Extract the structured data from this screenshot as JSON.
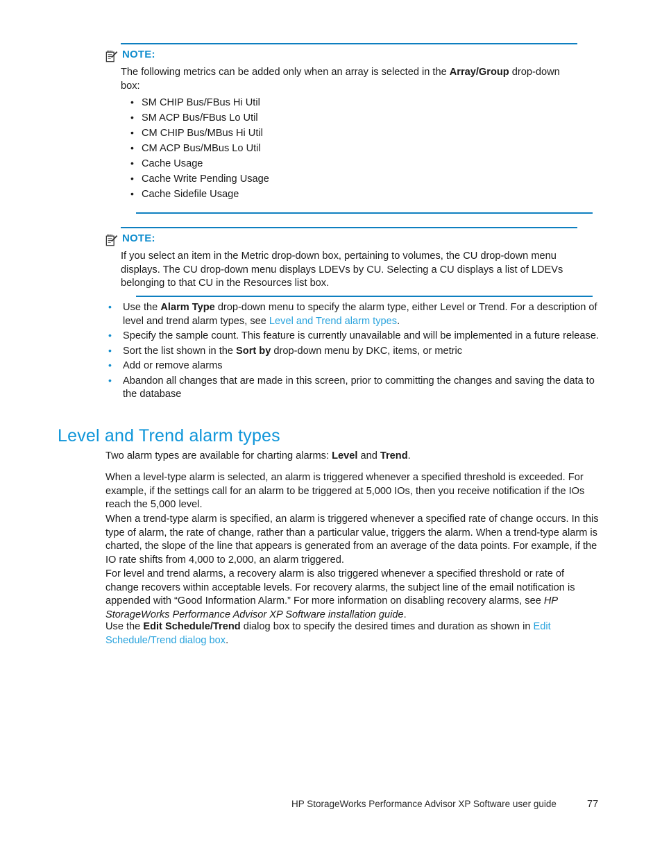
{
  "notes": [
    {
      "icon": "note-pencil-icon",
      "label": "NOTE:",
      "body": "The following metrics can be added only when an array is selected in the Array/Group drop-down box:",
      "body_pre": "The following metrics can be added only when an array is selected in the ",
      "body_bold": "Array/Group",
      "body_post": " drop-down box:",
      "items": [
        "SM CHIP Bus/FBus Hi Util",
        "SM ACP Bus/FBus Lo Util",
        "CM CHIP Bus/MBus Hi Util",
        "CM ACP Bus/MBus Lo Util",
        "Cache Usage",
        "Cache Write Pending Usage",
        "Cache Sidefile Usage"
      ]
    },
    {
      "icon": "note-pencil-icon",
      "label": "NOTE:",
      "body": "If you select an item in the Metric drop-down box, pertaining to volumes, the CU drop-down menu displays. The CU drop-down menu displays LDEVs by CU. Selecting a CU displays a list of LDEVs belonging to that CU in the Resources list box."
    }
  ],
  "main_bullets": [
    {
      "pre": "Use the ",
      "bold": "Alarm Type",
      "mid": " drop-down menu to specify the alarm type, either Level or Trend.  For a description of level and trend alarm types, see ",
      "link": "Level and Trend alarm types",
      "post": "."
    },
    {
      "pre": "Specify the sample count.  This feature is currently unavailable and will be implemented in a future release.",
      "bold": "",
      "mid": "",
      "link": "",
      "post": ""
    },
    {
      "pre": "Sort the list shown in the ",
      "bold": "Sort by",
      "mid": " drop-down menu by DKC, items, or metric",
      "link": "",
      "post": ""
    },
    {
      "pre": "Add or remove alarms",
      "bold": "",
      "mid": "",
      "link": "",
      "post": ""
    },
    {
      "pre": "Abandon all changes that are made in this screen, prior to committing the changes and saving the data to the database",
      "bold": "",
      "mid": "",
      "link": "",
      "post": ""
    }
  ],
  "section": {
    "heading": "Level and Trend alarm types",
    "p1_pre": "Two alarm types are available for charting alarms:  ",
    "p1_bold1": "Level",
    "p1_mid": " and ",
    "p1_bold2": "Trend",
    "p1_post": ".",
    "p2": "When a level-type alarm is selected, an alarm is triggered whenever a specified threshold is exceeded.  For example, if the settings call for an alarm to be triggered at 5,000 IOs, then you receive notification if the IOs reach the 5,000 level.",
    "p3": "When a trend-type alarm is specified, an alarm is triggered whenever a specified rate of change occurs.  In this type of alarm, the rate of change, rather than a particular value, triggers the alarm.  When a trend-type alarm is charted, the slope of the line that appears is generated from an average of the data points.  For example, if the IO rate shifts from 4,000 to 2,000, an alarm triggered.",
    "p4_pre": "For level and trend alarms, a recovery alarm is also triggered whenever a specified threshold or rate of change recovers within acceptable levels.  For recovery alarms, the subject line of the email notification is appended with “Good Information Alarm.”  For more information on disabling recovery alarms, see ",
    "p4_italic": "HP StorageWorks Performance Advisor XP Software installation guide",
    "p4_post": ".",
    "p5_pre": "Use the ",
    "p5_bold": "Edit Schedule/Trend",
    "p5_mid": " dialog box to specify the desired times and duration as shown in ",
    "p5_link": "Edit Schedule/Trend dialog box",
    "p5_post": "."
  },
  "footer": {
    "text": "HP StorageWorks Performance Advisor XP Software user guide",
    "page": "77"
  },
  "colors": {
    "accent": "#0e95d9",
    "rule": "#0e7fc0",
    "link": "#29a3dd",
    "text": "#1a1a1a"
  }
}
